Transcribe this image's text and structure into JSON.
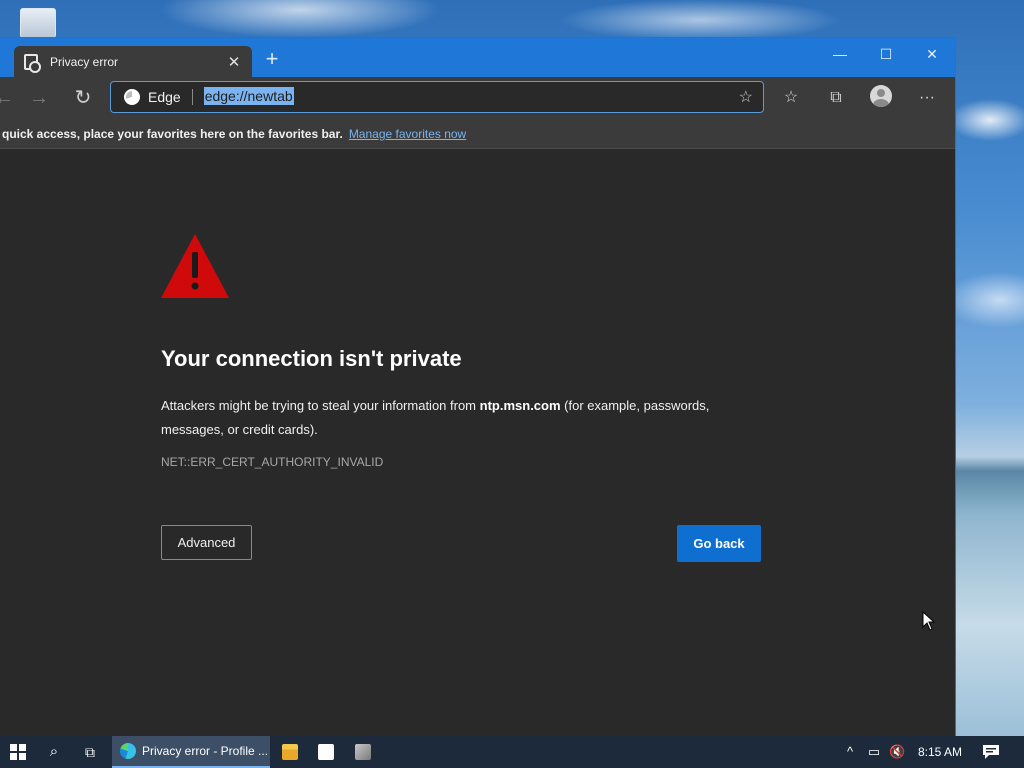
{
  "browser": {
    "tab_title": "Privacy error",
    "address_label": "Edge",
    "url": "edge://newtab",
    "favorites_bar": {
      "text": "quick access, place your favorites here on the favorites bar.",
      "link": "Manage favorites now"
    }
  },
  "page": {
    "heading": "Your connection isn't private",
    "description_before": "Attackers might be trying to steal your information from ",
    "host": "ntp.msn.com",
    "description_after": " (for example, passwords, messages, or credit cards).",
    "error_code": "NET::ERR_CERT_AUTHORITY_INVALID",
    "advanced_label": "Advanced",
    "go_back_label": "Go back",
    "warning_color": "#d00a0a",
    "accent_color": "#0f6fd0"
  },
  "taskbar": {
    "app_label": "Privacy error - Profile ...",
    "clock": "8:15 AM"
  },
  "icons": {
    "tab_icon": "page-icon",
    "close_tab": "close-icon",
    "new_tab": "plus-icon",
    "minimize": "minimize-icon",
    "maximize": "maximize-icon",
    "close_window": "close-icon",
    "back": "arrow-left-icon",
    "forward": "arrow-right-icon",
    "refresh": "refresh-icon",
    "add_favorite": "star-plus-icon",
    "favorites": "favorites-icon",
    "collections": "collections-icon",
    "profile": "profile-icon",
    "more": "ellipsis-icon",
    "warning": "warning-triangle-icon"
  }
}
